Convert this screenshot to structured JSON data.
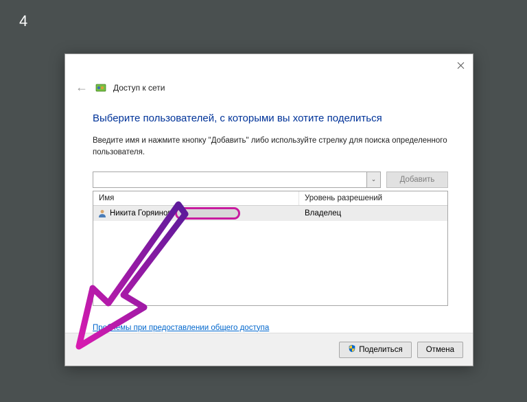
{
  "step_number": "4",
  "header": {
    "title": "Доступ к сети"
  },
  "content": {
    "heading": "Выберите пользователей, с которыми вы хотите поделиться",
    "instructions": "Введите имя и нажмите кнопку \"Добавить\" либо используйте стрелку для поиска определенного пользователя.",
    "add_button": "Добавить",
    "table": {
      "columns": {
        "name": "Имя",
        "permission": "Уровень разрешений"
      },
      "rows": [
        {
          "name": "Никита Горяинов",
          "permission": "Владелец"
        }
      ]
    },
    "help_link": "Проблемы при предоставлении общего доступа"
  },
  "footer": {
    "share": "Поделиться",
    "cancel": "Отмена"
  }
}
